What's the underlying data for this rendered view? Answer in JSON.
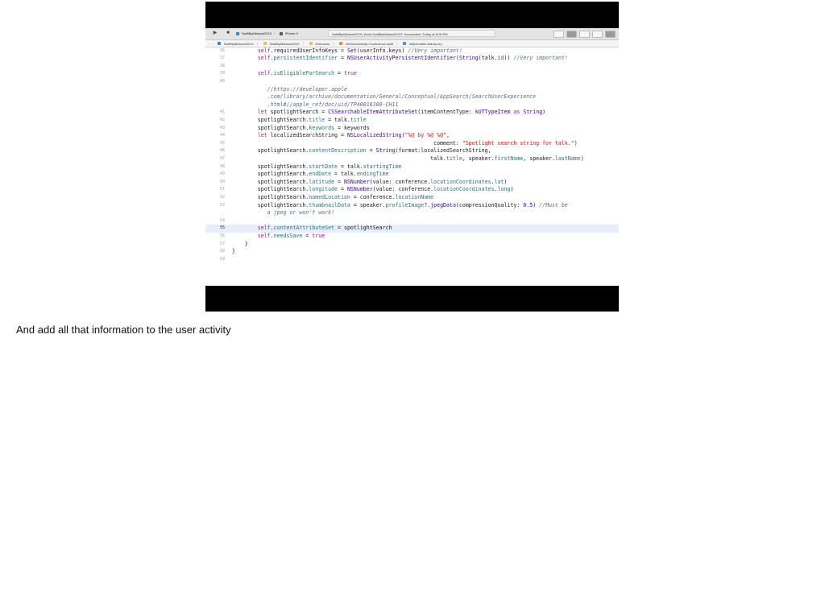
{
  "toolbar": {
    "run_icon": "▶",
    "stop_icon": "■",
    "scheme_target": "SwiftByMidwest2019",
    "scheme_device": "iPhone X",
    "status": "SwiftByMidwest2019 | Build SwiftByMidwest2019: Succeeded | Today at 8:28 PM"
  },
  "jumpbar": {
    "items": [
      "SwiftByMidwest2019",
      "SwiftByMidwest2019",
      "Extension",
      "NSUserActivity+Conference.swift",
      "init(identifier:talk:by:at:)"
    ]
  },
  "editor": {
    "lines": [
      {
        "n": "36",
        "html": "        <span class=\"kw\">self</span>.requiredUserInfoKeys = <span class=\"ty\">Set</span>(userInfo.keys) <span class=\"cm\">//Very important!</span>"
      },
      {
        "n": "37",
        "html": "        <span class=\"kw\">self</span>.<span class=\"pr\">persistentIdentifier</span> = <span class=\"ty\">NSUserActivityPersistentIdentifier</span>(<span class=\"ty\">String</span>(talk.<span class=\"pr\">id</span>)) <span class=\"cm\">//Very important!</span>"
      },
      {
        "n": "38",
        "html": ""
      },
      {
        "n": "39",
        "html": "        <span class=\"kw\">self</span>.<span class=\"pr\">isEligibleForSearch</span> = <span class=\"kw\">true</span>"
      },
      {
        "n": "40",
        "html": ""
      },
      {
        "n": "",
        "html": "           <span class=\"cm\">//https://developer.apple</span>"
      },
      {
        "n": "",
        "html": "           <span class=\"cm\">.com/library/archive/documentation/General/Conceptual/AppSearch/SearchUserExperience</span>"
      },
      {
        "n": "",
        "html": "           <span class=\"cm\">.html#//apple_ref/doc/uid/TP40016308-CH11</span>"
      },
      {
        "n": "41",
        "html": "        <span class=\"kw\">let</span> spotlightSearch = <span class=\"ty\">CSSearchableItemAttributeSet</span>(itemContentType: <span class=\"ty\">kUTTypeItem</span> <span class=\"kw\">as</span> <span class=\"ty\">String</span>)"
      },
      {
        "n": "42",
        "html": "        spotlightSearch.<span class=\"pr\">title</span> = talk.<span class=\"pr\">title</span>"
      },
      {
        "n": "43",
        "html": "        spotlightSearch.<span class=\"pr\">keywords</span> = keywords"
      },
      {
        "n": "44",
        "html": "        <span class=\"kw\">let</span> localizedSearchString = <span class=\"ty\">NSLocalizedString</span>(<span class=\"st\">\"%@ by %@ %@\"</span>,"
      },
      {
        "n": "45",
        "html": "                                                               comment: <span class=\"st\">\"Spotlight search string for talk.\"</span>)"
      },
      {
        "n": "46",
        "html": "        spotlightSearch.<span class=\"pr\">contentDescription</span> = <span class=\"ty\">String</span>(format:localizedSearchString,"
      },
      {
        "n": "47",
        "html": "                                                              talk.<span class=\"pr\">title</span>, speaker.<span class=\"pr\">firstName</span>, speaker.<span class=\"pr\">lastName</span>)"
      },
      {
        "n": "48",
        "html": "        spotlightSearch.<span class=\"pr\">startDate</span> = talk.<span class=\"pr\">startingTime</span>"
      },
      {
        "n": "49",
        "html": "        spotlightSearch.<span class=\"pr\">endDate</span> = talk.<span class=\"pr\">endingTime</span>"
      },
      {
        "n": "50",
        "html": "        spotlightSearch.<span class=\"pr\">latitude</span> = <span class=\"ty\">NSNumber</span>(value: conference.<span class=\"pr\">locationCoordinates</span>.<span class=\"pr\">lat</span>)"
      },
      {
        "n": "51",
        "html": "        spotlightSearch.<span class=\"pr\">longitude</span> = <span class=\"ty\">NSNumber</span>(value: conference.<span class=\"pr\">locationCoordinates</span>.<span class=\"pr\">long</span>)"
      },
      {
        "n": "52",
        "html": "        spotlightSearch.<span class=\"pr\">namedLocation</span> = conference.<span class=\"pr\">locationName</span>"
      },
      {
        "n": "53",
        "html": "        spotlightSearch.<span class=\"pr\">thumbnailData</span> = speaker.<span class=\"pr\">profileImage</span>?.<span class=\"ty\">jpegData</span>(compressionQuality: <span class=\"nm\">0.5</span>) <span class=\"cm\">//Must be</span>"
      },
      {
        "n": "",
        "html": "           <span class=\"cm\">a jpeg or won't work!</span>"
      },
      {
        "n": "54",
        "html": ""
      },
      {
        "n": "55",
        "html": "        <span class=\"kw\">self</span>.<span class=\"pr\">contentAttributeSet</span> = spotlightSearch",
        "current": true
      },
      {
        "n": "56",
        "html": "        <span class=\"kw\">self</span>.<span class=\"pr\">needsSave</span> = <span class=\"kw\">true</span>"
      },
      {
        "n": "57",
        "html": "    }"
      },
      {
        "n": "58",
        "html": "}"
      },
      {
        "n": "59",
        "html": ""
      }
    ]
  },
  "caption": "And add all that information to the user activity"
}
